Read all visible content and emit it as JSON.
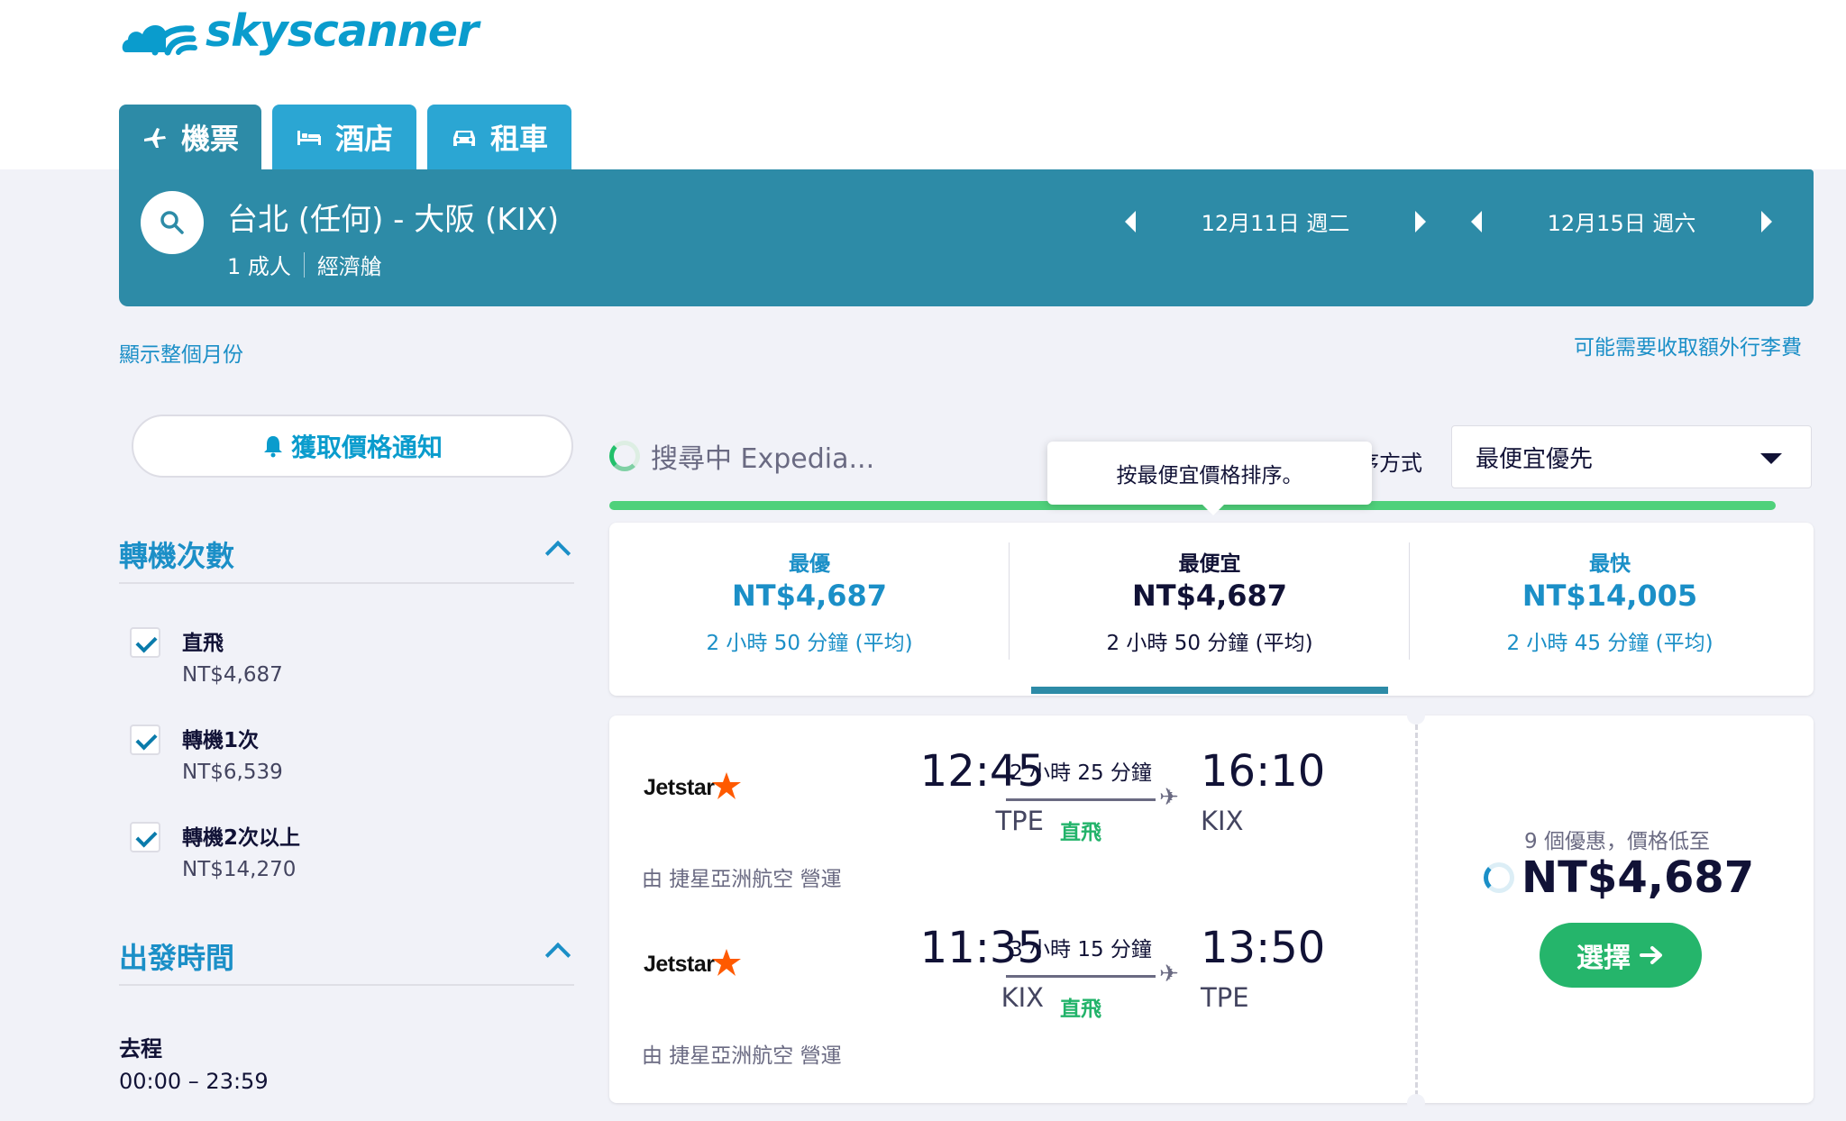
{
  "brand": {
    "name": "skyscanner",
    "color": "#0a9ccd"
  },
  "tabs": [
    {
      "label": "機票",
      "icon": "plane-icon",
      "active": true
    },
    {
      "label": "酒店",
      "icon": "bed-icon",
      "active": false
    },
    {
      "label": "租車",
      "icon": "car-icon",
      "active": false
    }
  ],
  "search": {
    "route": "台北 (任何) - 大阪 (KIX)",
    "passengers": "1 成人",
    "cabin": "經濟艙",
    "depart_date": "12月11日 週二",
    "return_date": "12月15日 週六"
  },
  "links": {
    "show_month": "顯示整個月份",
    "baggage_fee": "可能需要收取額外行李費"
  },
  "price_alert": {
    "label": "獲取價格通知"
  },
  "filters": {
    "stops": {
      "title": "轉機次數",
      "options": [
        {
          "label": "直飛",
          "price": "NT$4,687",
          "checked": true
        },
        {
          "label": "轉機1次",
          "price": "NT$6,539",
          "checked": true
        },
        {
          "label": "轉機2次以上",
          "price": "NT$14,270",
          "checked": true
        }
      ]
    },
    "departure_time": {
      "title": "出發時間",
      "outbound_label": "去程",
      "outbound_range": "00:00 – 23:59"
    }
  },
  "status": {
    "searching": "搜尋中 Expedia..."
  },
  "sort": {
    "label": "排序方式",
    "label_visible": "序方式",
    "value": "最便宜優先",
    "tooltip": "按最便宜價格排序。"
  },
  "summary": [
    {
      "label": "最優",
      "price": "NT$4,687",
      "duration": "2 小時 50 分鐘 (平均)"
    },
    {
      "label": "最便宜",
      "price": "NT$4,687",
      "duration": "2 小時 50 分鐘 (平均)",
      "selected": true
    },
    {
      "label": "最快",
      "price": "NT$14,005",
      "duration": "2 小時 45 分鐘 (平均)"
    }
  ],
  "result": {
    "legs": [
      {
        "airline": "Jetstar",
        "depart_time": "12:45",
        "depart_code": "TPE",
        "duration": "2 小時 25 分鐘",
        "stops": "直飛",
        "arrive_time": "16:10",
        "arrive_code": "KIX",
        "operated_by": "由 捷星亞洲航空 營運"
      },
      {
        "airline": "Jetstar",
        "depart_time": "11:35",
        "depart_code": "KIX",
        "duration": "3 小時 15 分鐘",
        "stops": "直飛",
        "arrive_time": "13:50",
        "arrive_code": "TPE",
        "operated_by": "由 捷星亞洲航空 營運"
      }
    ],
    "deals_text": "9 個優惠，價格低至",
    "price": "NT$4,687",
    "select_label": "選擇"
  },
  "colors": {
    "header_teal": "#2d8ba7",
    "tab_blue": "#2ba6d3",
    "link_blue": "#1b8fc7",
    "progress_green": "#4fd17b",
    "select_green": "#25b56b",
    "jetstar_orange": "#ff5a00"
  }
}
